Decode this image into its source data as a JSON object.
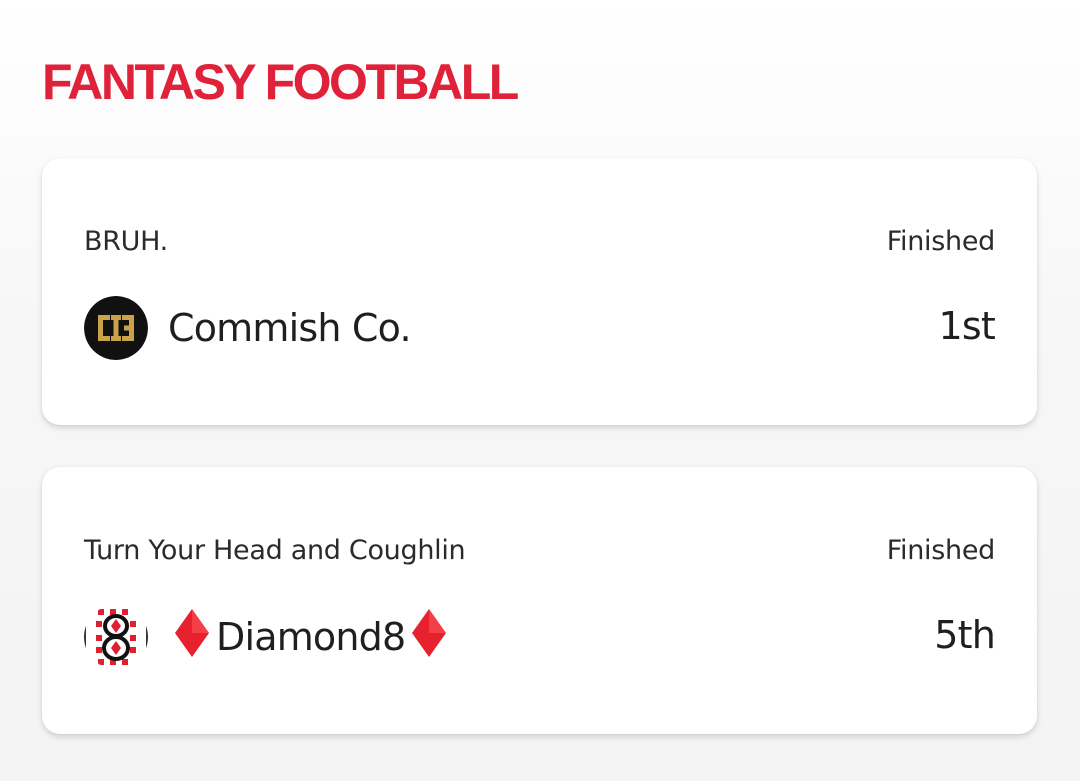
{
  "section": {
    "title": "FANTASY FOOTBALL"
  },
  "colors": {
    "accent": "#e0213a",
    "diamond_red": "#e8212e",
    "commish_gold": "#c9a24a"
  },
  "leagues": [
    {
      "league_name": "BRUH.",
      "status": "Finished",
      "team_name": "Commish Co.",
      "rank": "1st",
      "avatar_icon": "commish-co-logo-icon"
    },
    {
      "league_name": "Turn Your Head and Coughlin",
      "status": "Finished",
      "team_name": "Diamond8",
      "rank": "5th",
      "avatar_icon": "diamond8-logo-icon"
    }
  ]
}
